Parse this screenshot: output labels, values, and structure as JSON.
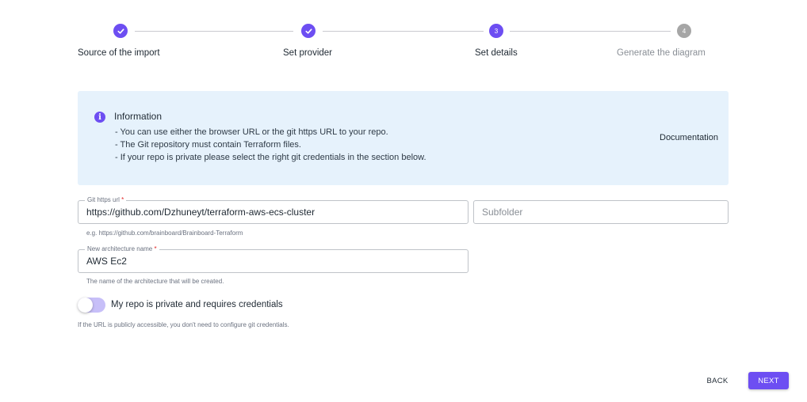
{
  "stepper": {
    "steps": [
      {
        "label": "Source of the import",
        "status": "done",
        "number": "1"
      },
      {
        "label": "Set provider",
        "status": "done",
        "number": "2"
      },
      {
        "label": "Set details",
        "status": "active",
        "number": "3"
      },
      {
        "label": "Generate the diagram",
        "status": "pending",
        "number": "4"
      }
    ],
    "done_icon": "check-icon"
  },
  "info": {
    "icon": "info-icon",
    "icon_glyph": "i",
    "title": "Information",
    "lines": [
      "- You can use either the browser URL or the git https URL to your repo.",
      "- The Git repository must contain Terraform files.",
      "- If your repo is private please select the right git credentials in the section below."
    ],
    "documentation_link": "Documentation"
  },
  "form": {
    "git_url": {
      "label": "Git https url",
      "required_mark": "*",
      "value": "https://github.com/Dzhuneyt/terraform-aws-ecs-cluster",
      "helper": "e.g. https://github.com/brainboard/Brainboard-Terraform"
    },
    "subfolder": {
      "placeholder": "Subfolder",
      "value": ""
    },
    "architecture_name": {
      "label": "New architecture name",
      "required_mark": "*",
      "value": "AWS Ec2",
      "helper": "The name of the architecture that will be created."
    },
    "private_repo": {
      "label": "My repo is private and requires credentials",
      "checked": false,
      "helper": "If the URL is publicly accessible, you don't need to configure git credentials."
    }
  },
  "actions": {
    "back_label": "BACK",
    "next_label": "NEXT"
  },
  "colors": {
    "accent": "#6d4ef2",
    "info_background": "#e6f2fc",
    "pending": "#a6a6a6"
  }
}
